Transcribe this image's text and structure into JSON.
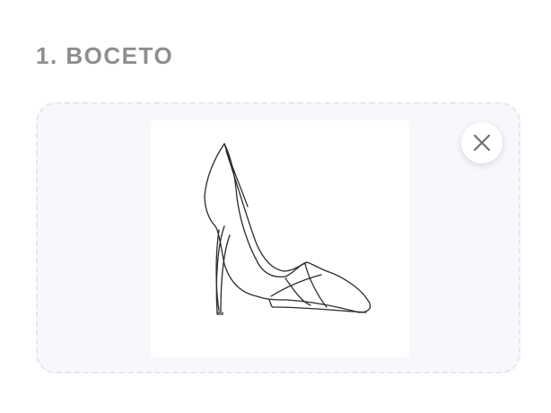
{
  "section": {
    "title": "1. BOCETO"
  },
  "upload": {
    "image_subject": "high-heel-shoe-sketch",
    "remove_icon": "close-icon"
  },
  "colors": {
    "title": "#8e8e8e",
    "dropzone_bg": "#f7f8fb",
    "dropzone_border": "#e6e7ec",
    "icon": "#707070"
  }
}
